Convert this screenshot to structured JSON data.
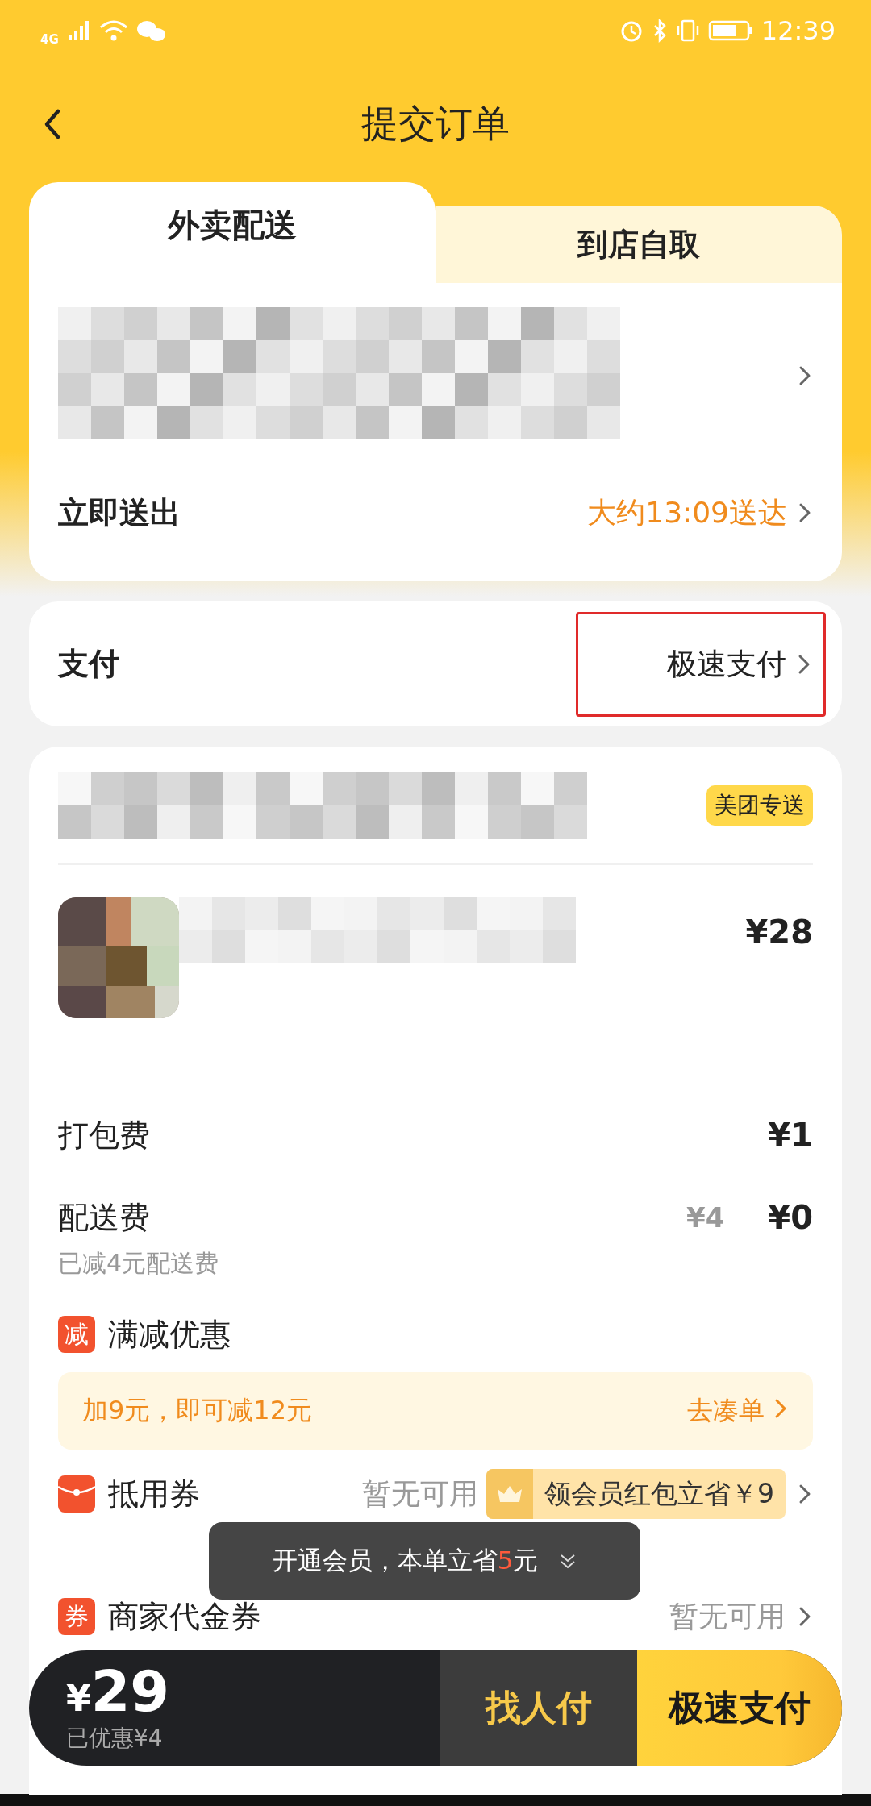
{
  "status_bar": {
    "network": "4G",
    "time": "12:39"
  },
  "header": {
    "title": "提交订单"
  },
  "tabs": [
    {
      "label": "外卖配送",
      "selected": true
    },
    {
      "label": "到店自取",
      "selected": false
    }
  ],
  "delivery": {
    "label": "立即送出",
    "eta": "大约13:09送达"
  },
  "payment": {
    "label": "支付",
    "value": "极速支付",
    "highlighted": true
  },
  "shop": {
    "badge": "美团专送"
  },
  "item": {
    "price": "¥28"
  },
  "fees": [
    {
      "kind": "fee",
      "label": "打包费",
      "price": "¥1"
    },
    {
      "kind": "discounted",
      "label": "配送费",
      "original_price": "¥4",
      "price": "¥0",
      "note": "已减4元配送费"
    }
  ],
  "discount": {
    "icon": "减",
    "label": "满减优惠",
    "promo": "加9元，即可减12元",
    "promo_link": "去凑单"
  },
  "coupons": [
    {
      "kind": "red-packet",
      "label": "抵用券",
      "value": "暂无可用",
      "offer": "领会员红包立省￥9"
    },
    {
      "kind": "voucher",
      "icon": "券",
      "label": "商家代金券",
      "value": "暂无可用"
    }
  ],
  "toast": {
    "text": "开通会员，本单立省",
    "amount": "5",
    "unit": "元"
  },
  "pay_bar": {
    "currency": "¥",
    "total": "29",
    "saved": "已优惠¥4",
    "buttons": [
      {
        "kind": "secondary",
        "label": "找人付"
      },
      {
        "kind": "primary",
        "label": "极速支付"
      }
    ]
  }
}
